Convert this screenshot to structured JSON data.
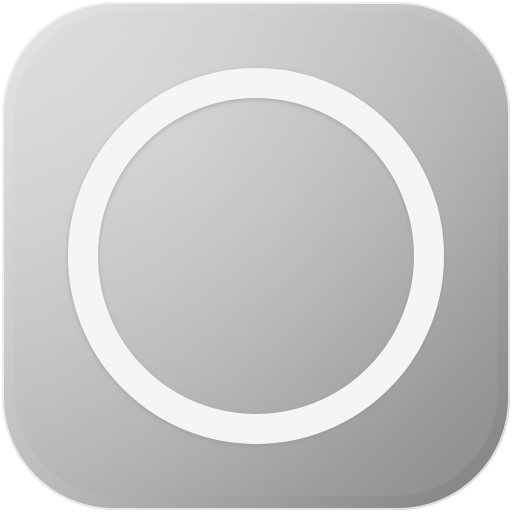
{
  "icon": {
    "name": "ring-icon",
    "colors": {
      "tile_light": "#e6e7e9",
      "tile_mid": "#bcbdbf",
      "tile_dark": "#7e7f81",
      "edge_highlight": "#f4f5f6",
      "ring": "#f5f5f7",
      "ring_shadow": "#8f9092"
    }
  }
}
